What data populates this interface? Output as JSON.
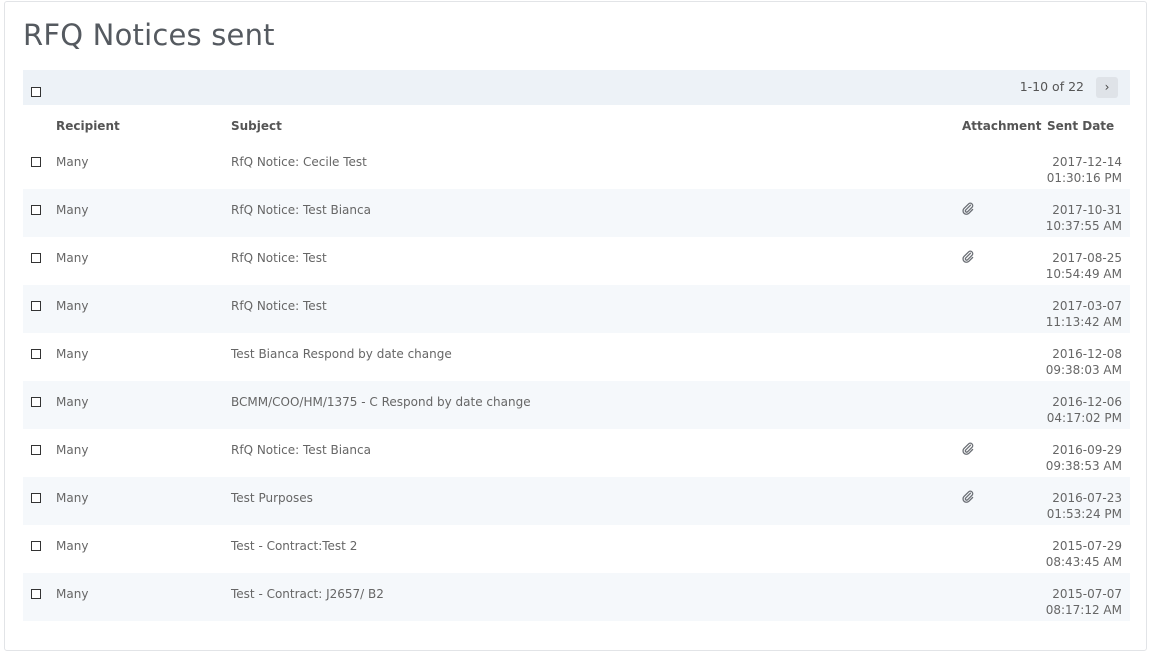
{
  "page": {
    "title": "RFQ Notices sent"
  },
  "toolbar": {
    "pagination": "1-10 of 22",
    "next_label": "›"
  },
  "columns": {
    "recipient": "Recipient",
    "subject": "Subject",
    "attachment": "Attachment",
    "sent_date": "Sent Date"
  },
  "rows": [
    {
      "recipient": "Many",
      "subject": "RfQ Notice: Cecile Test",
      "attachment": false,
      "date": "2017-12-14",
      "time": "01:30:16 PM"
    },
    {
      "recipient": "Many",
      "subject": "RfQ Notice: Test Bianca",
      "attachment": true,
      "date": "2017-10-31",
      "time": "10:37:55 AM"
    },
    {
      "recipient": "Many",
      "subject": "RfQ Notice: Test",
      "attachment": true,
      "date": "2017-08-25",
      "time": "10:54:49 AM"
    },
    {
      "recipient": "Many",
      "subject": "RfQ Notice: Test",
      "attachment": false,
      "date": "2017-03-07",
      "time": "11:13:42 AM"
    },
    {
      "recipient": "Many",
      "subject": "Test Bianca Respond by date change",
      "attachment": false,
      "date": "2016-12-08",
      "time": "09:38:03 AM"
    },
    {
      "recipient": "Many",
      "subject": "BCMM/COO/HM/1375 - C Respond by date change",
      "attachment": false,
      "date": "2016-12-06",
      "time": "04:17:02 PM"
    },
    {
      "recipient": "Many",
      "subject": "RfQ Notice: Test Bianca",
      "attachment": true,
      "date": "2016-09-29",
      "time": "09:38:53 AM"
    },
    {
      "recipient": "Many",
      "subject": "Test Purposes",
      "attachment": true,
      "date": "2016-07-23",
      "time": "01:53:24 PM"
    },
    {
      "recipient": "Many",
      "subject": "Test - Contract:Test 2",
      "attachment": false,
      "date": "2015-07-29",
      "time": "08:43:45 AM"
    },
    {
      "recipient": "Many",
      "subject": "Test - Contract: J2657/ B2",
      "attachment": false,
      "date": "2015-07-07",
      "time": "08:17:12 AM"
    }
  ]
}
